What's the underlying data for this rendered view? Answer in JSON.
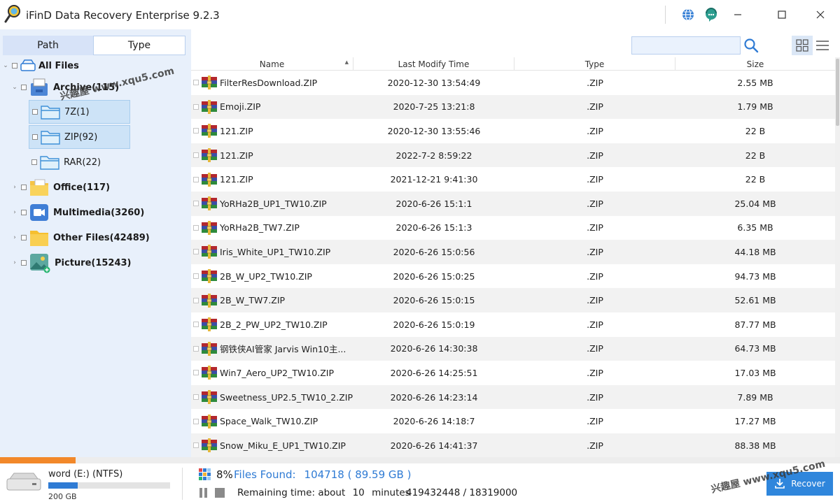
{
  "app": {
    "title": "iFinD Data Recovery Enterprise 9.2.3",
    "window_controls": [
      "minimize",
      "maximize",
      "close"
    ],
    "accent_color": "#2f7bd4",
    "progress_color": "#f2882a"
  },
  "left_panel": {
    "tabs": [
      {
        "label": "Path",
        "selected": false
      },
      {
        "label": "Type",
        "selected": true
      }
    ],
    "tree": {
      "root_label": "All Files",
      "archive_label": "Archive(115)",
      "archive_children": [
        {
          "label": "7Z(1)",
          "selected": true
        },
        {
          "label": "ZIP(92)",
          "selected": true
        },
        {
          "label": "RAR(22)",
          "selected": false
        }
      ],
      "office_label": "Office(117)",
      "multimedia_label": "Multimedia(3260)",
      "other_label": "Other Files(42489)",
      "picture_label": "Picture(15243)"
    }
  },
  "toolbar": {
    "search_placeholder": "",
    "view_modes": [
      "grid-view-icon",
      "list-view-icon"
    ]
  },
  "table": {
    "columns": [
      "Name",
      "Last Modify Time",
      "Type",
      "Size"
    ],
    "sort_column": "Name",
    "rows": [
      {
        "name": "FilterResDownload.ZIP",
        "time": "2020-12-30 13:54:49",
        "type": ".ZIP",
        "size": "2.55 MB"
      },
      {
        "name": "Emoji.ZIP",
        "time": "2020-7-25 13:21:8",
        "type": ".ZIP",
        "size": "1.79 MB"
      },
      {
        "name": "121.ZIP",
        "time": "2020-12-30 13:55:46",
        "type": ".ZIP",
        "size": "22 B"
      },
      {
        "name": "121.ZIP",
        "time": "2022-7-2 8:59:22",
        "type": ".ZIP",
        "size": "22 B"
      },
      {
        "name": "121.ZIP",
        "time": "2021-12-21 9:41:30",
        "type": ".ZIP",
        "size": "22 B"
      },
      {
        "name": "YoRHa2B_UP1_TW10.ZIP",
        "time": "2020-6-26 15:1:1",
        "type": ".ZIP",
        "size": "25.04 MB"
      },
      {
        "name": "YoRHa2B_TW7.ZIP",
        "time": "2020-6-26 15:1:3",
        "type": ".ZIP",
        "size": "6.35 MB"
      },
      {
        "name": "Iris_White_UP1_TW10.ZIP",
        "time": "2020-6-26 15:0:56",
        "type": ".ZIP",
        "size": "44.18 MB"
      },
      {
        "name": "2B_W_UP2_TW10.ZIP",
        "time": "2020-6-26 15:0:25",
        "type": ".ZIP",
        "size": "94.73 MB"
      },
      {
        "name": "2B_W_TW7.ZIP",
        "time": "2020-6-26 15:0:15",
        "type": ".ZIP",
        "size": "52.61 MB"
      },
      {
        "name": "2B_2_PW_UP2_TW10.ZIP",
        "time": "2020-6-26 15:0:19",
        "type": ".ZIP",
        "size": "87.77 MB"
      },
      {
        "name": "钢铁侠AI管家 Jarvis Win10主...",
        "time": "2020-6-26 14:30:38",
        "type": ".ZIP",
        "size": "64.73 MB"
      },
      {
        "name": "Win7_Aero_UP2_TW10.ZIP",
        "time": "2020-6-26 14:25:51",
        "type": ".ZIP",
        "size": "17.03 MB"
      },
      {
        "name": "Sweetness_UP2.5_TW10_2.ZIP",
        "time": "2020-6-26 14:23:14",
        "type": ".ZIP",
        "size": "7.89 MB"
      },
      {
        "name": "Space_Walk_TW10.ZIP",
        "time": "2020-6-26 14:18:7",
        "type": ".ZIP",
        "size": "17.27 MB"
      },
      {
        "name": "Snow_Miku_E_UP1_TW10.ZIP",
        "time": "2020-6-26 14:41:37",
        "type": ".ZIP",
        "size": "88.38 MB"
      }
    ]
  },
  "status": {
    "scan_progress": 0.09,
    "drive_name": "word (E:) (NTFS)",
    "drive_size": "200 GB",
    "drive_used_fraction": 0.24,
    "percent": "8%",
    "files_found_label": "Files Found:",
    "files_found_value": "104718 ( 89.59 GB )",
    "remaining_label": "Remaining time: about",
    "remaining_value": "10",
    "remaining_unit": "minutes",
    "sectors": "419432448 / 18319000",
    "recover_label": "Recover"
  },
  "watermark": {
    "text": "兴趣屋 www.xqu5.com"
  }
}
